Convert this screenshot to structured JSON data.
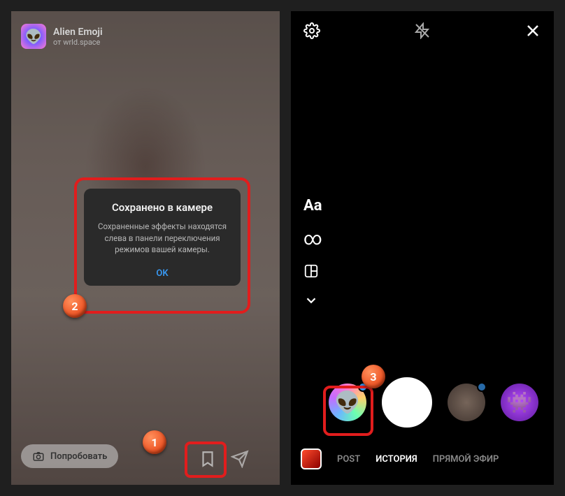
{
  "left": {
    "effect_name": "Alien Emoji",
    "effect_author_prefix": "от",
    "effect_author": "wrld.space",
    "dialog": {
      "title": "Сохранено в камере",
      "body": "Сохраненные эффекты находятся слева в панели переключения режимов вашей камеры.",
      "ok": "OK"
    },
    "try_label": "Попробовать"
  },
  "right": {
    "tools": {
      "text": "Aa",
      "boomerang": "∞"
    },
    "tabs": {
      "post": "POST",
      "story": "ИСТОРИЯ",
      "live": "ПРЯМОЙ ЭФИР"
    }
  },
  "steps": {
    "one": "1",
    "two": "2",
    "three": "3"
  }
}
